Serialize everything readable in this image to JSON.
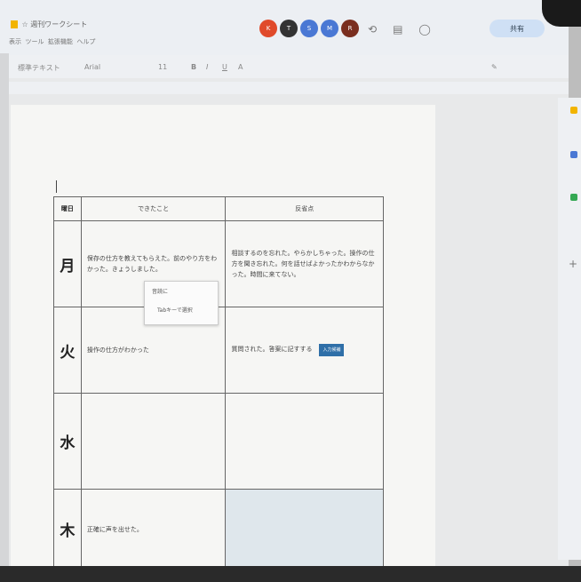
{
  "header": {
    "doc_title": "週刊ワークシート",
    "menu": [
      "表示",
      "ツール",
      "拡張機能",
      "ヘルプ"
    ],
    "avatars": [
      "K",
      "T",
      "S",
      "M",
      "R"
    ],
    "share_label": "共有"
  },
  "toolbar": {
    "style": "標準テキスト",
    "font": "Arial",
    "size": "11"
  },
  "table": {
    "headers": [
      "曜日",
      "できたこと",
      "反省点"
    ],
    "rows": [
      {
        "day": "月",
        "done": "保存の仕方を教えてもらえた。前のやり方をわかった。きょうしました。",
        "reflection": "相談するのを忘れた。やらかしちゃった。操作の仕方を聞き忘れた。何を話せばよかったかわからなかった。時間に来てない。"
      },
      {
        "day": "火",
        "done": "操作の仕方がわかった",
        "reflection": "質問された。答案に記すする"
      },
      {
        "day": "水",
        "done": "",
        "reflection": ""
      },
      {
        "day": "木",
        "done": "正確に声を出せた。",
        "reflection": ""
      }
    ]
  },
  "popup": {
    "item1": "音読に",
    "item2": "Tabキーで選択"
  },
  "badge": "入力候補"
}
